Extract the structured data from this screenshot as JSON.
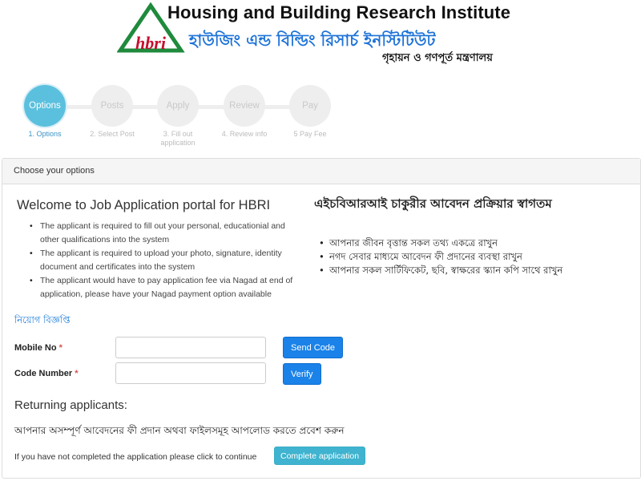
{
  "header": {
    "title_en": "Housing and Building Research Institute",
    "title_bn": "হাউজিং এন্ড বিল্ডিং রিসার্চ ইনস্টিটিউট",
    "subtitle_bn": "গৃহায়ন ও গণপূর্ত মন্ত্রণালয়",
    "logo_text": "hbri"
  },
  "stepper": {
    "steps": [
      {
        "circle": "Options",
        "label": "1. Options",
        "active": true
      },
      {
        "circle": "Posts",
        "label": "2. Select Post",
        "active": false
      },
      {
        "circle": "Apply",
        "label": "3. Fill out application",
        "active": false
      },
      {
        "circle": "Review",
        "label": "4. Review info",
        "active": false
      },
      {
        "circle": "Pay",
        "label": "5 Pay Fee",
        "active": false
      }
    ]
  },
  "panel": {
    "heading": "Choose your options",
    "welcome_en": "Welcome to Job Application portal for HBRI",
    "points_en": [
      "The applicant is required to fill out your personal, educationial and other qualifications into the system",
      "The applicant is required to upload your photo, signature, identity document and certificates into the system",
      "The applicant would have to pay application fee via Nagad at end of application, please have your Nagad payment option available"
    ],
    "welcome_bn": "এইচবিআরআই চাকুরীর আবেদন প্রক্রিয়ার স্বাগতম",
    "points_bn": [
      "আপনার জীবন বৃত্তান্ত সকল তথ্য একত্রে রাখুন",
      "নগদ সেবার মাধ্যমে আবেদন ফী প্রদানের ব্যবস্থা রাখুন",
      "আপনার সকল সার্টিফিকেট, ছবি, স্বাক্ষরের স্ক্যান কপি সাথে রাখুন"
    ],
    "notice_link": "নিয়োগ বিজ্ঞপ্তি"
  },
  "form": {
    "mobile_label": "Mobile No",
    "mobile_value": "",
    "send_code": "Send Code",
    "code_label": "Code Number",
    "code_value": "",
    "verify": "Verify",
    "required_mark": "*"
  },
  "returning": {
    "heading": "Returning applicants:",
    "text_bn": "আপনার অসম্পূর্ণ আবেদনের ফী প্রদান অথবা ফাইলসমূহ আপলোড করতে প্রবেশ করুন",
    "text_en": "If you have not completed the application please click to continue",
    "button": "Complete application"
  },
  "colors": {
    "active_step": "#5bc0de",
    "primary_button": "#1a82e8",
    "info_button": "#3fb3cf",
    "link": "#1a7bd8",
    "title_bn": "#1e73d8",
    "logo_red": "#c8102e",
    "logo_green": "#1f8a3c"
  }
}
